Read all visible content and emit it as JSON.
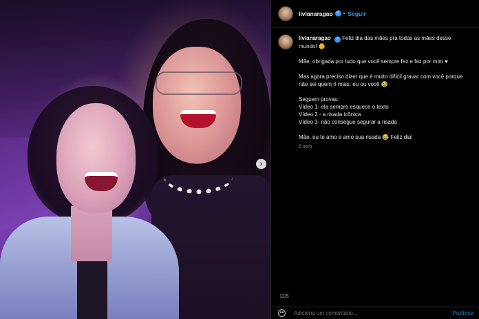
{
  "post": {
    "username": "livianaragao",
    "follow_label": "Seguir",
    "caption_lines": [
      "Feliz dia das mães pra todas as mães desse mundo! 🌼",
      "Mãe, obrigada por tudo que você sempre fez e faz por mim ♥",
      "Mas agora preciso dizer que é muito difícil gravar com você porque não sei quem ri mais: eu ou você 😂",
      "Seguem provas:",
      "Vídeo 1- ela sempre esquece o texto",
      "Vídeo 2 - a risada icônica",
      "Vídeo 3- não consegue segurar a risada",
      "Mãe, eu te amo e amo sua risada 😂  Feliz dia!"
    ],
    "time_ago": "6 sem",
    "page_indicator": "12/5"
  },
  "comment": {
    "placeholder": "Adiciona um comentário...",
    "publish_label": "Publicar"
  },
  "icons": {
    "next": "chevron-right-icon",
    "verified": "verified-badge-icon",
    "emoji": "emoji-icon"
  },
  "colors": {
    "accent": "#3897f0",
    "background": "#000000",
    "text": "#f5f5f5"
  }
}
